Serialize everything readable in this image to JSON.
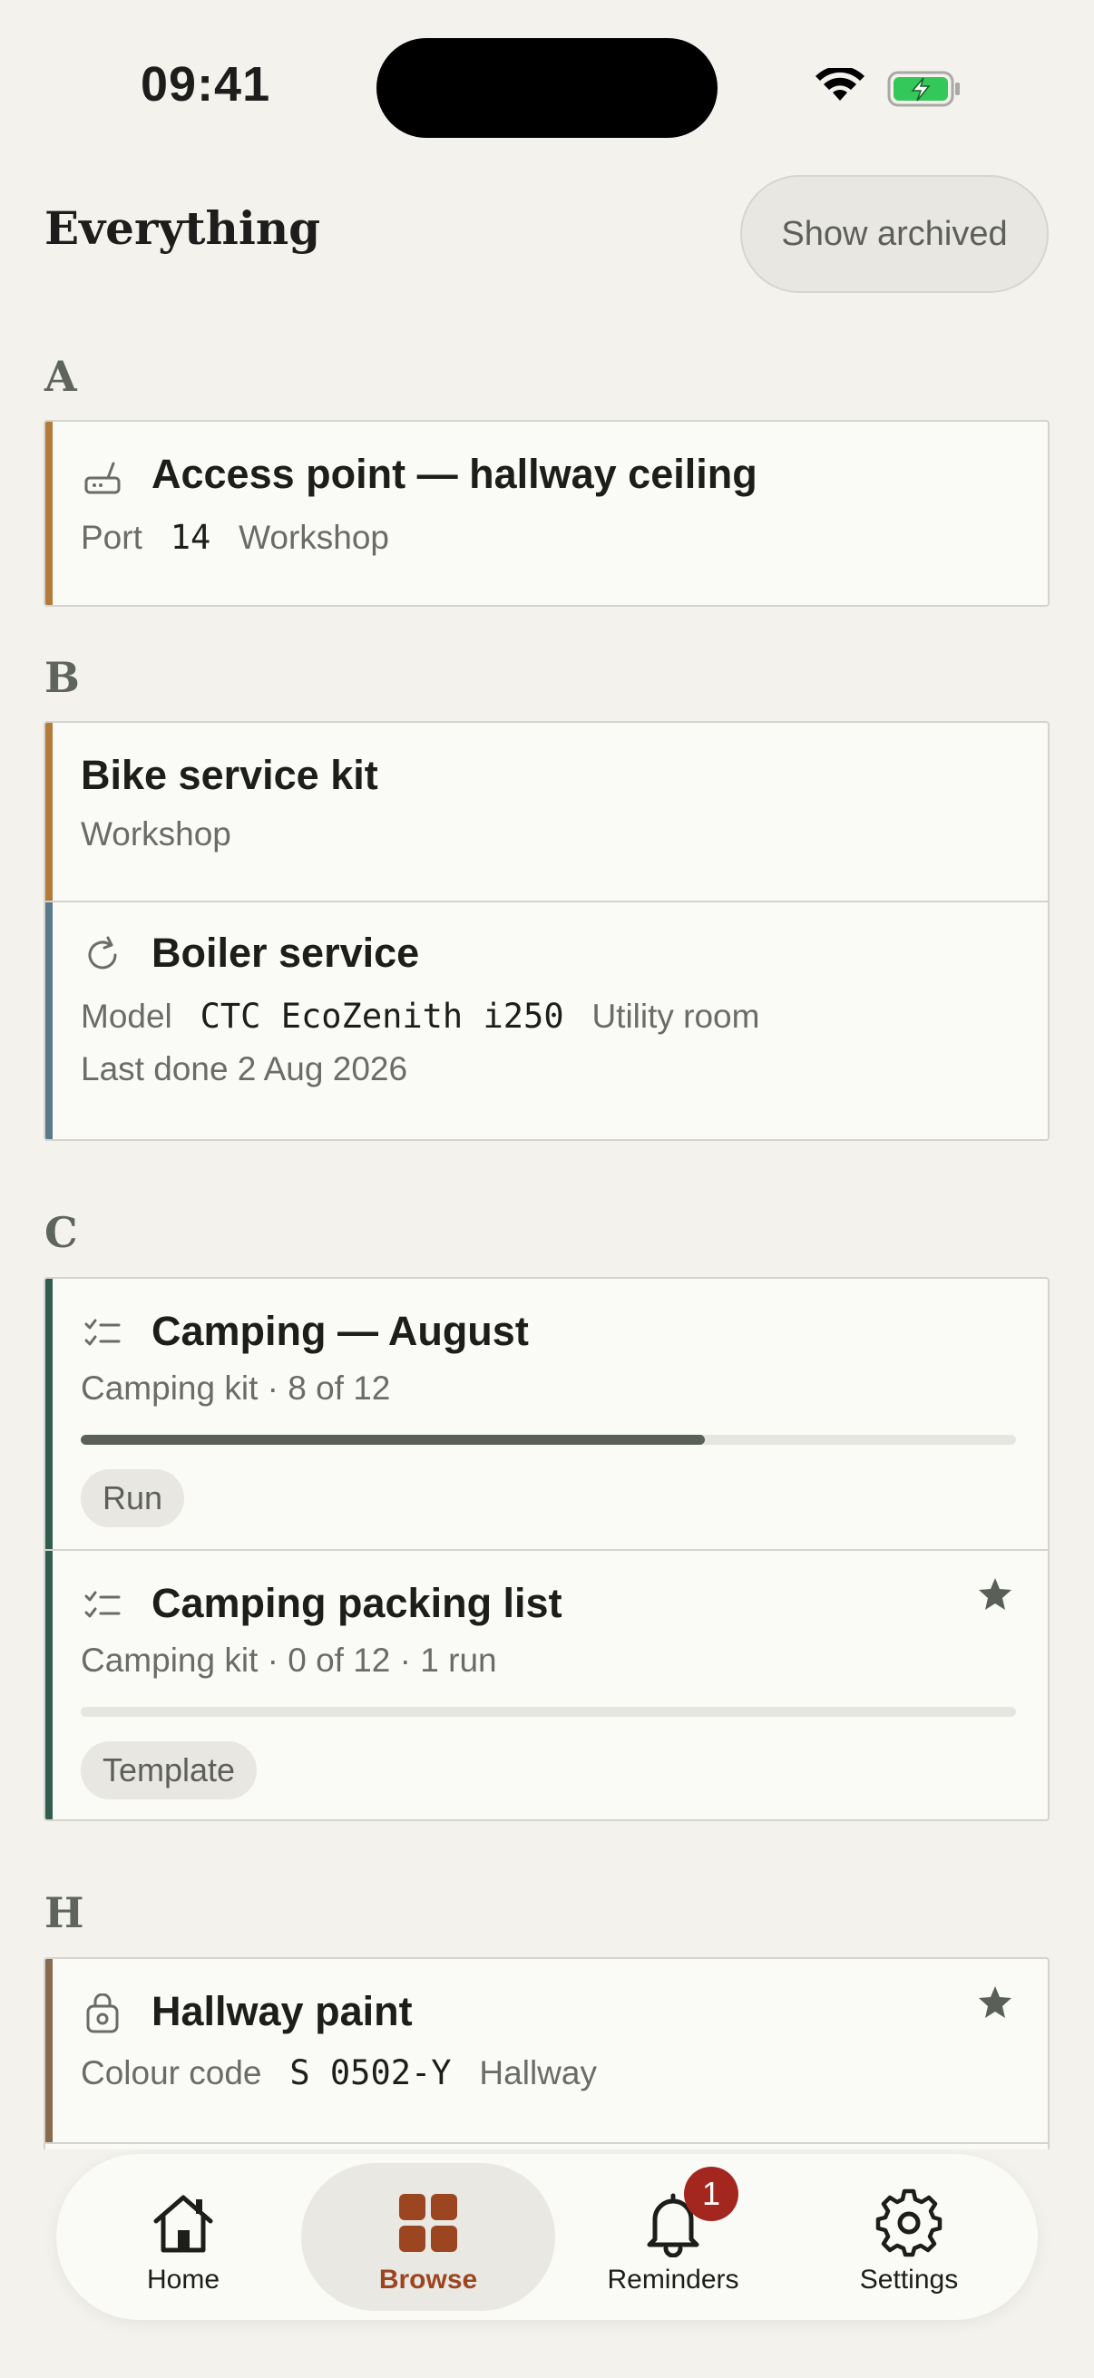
{
  "status_bar": {
    "time": "09:41"
  },
  "header": {
    "title": "Everything",
    "show_archived_label": "Show archived"
  },
  "sections": {
    "a": {
      "letter": "A",
      "items": [
        {
          "title": "Access point — hallway ceiling",
          "sub_label": "Port",
          "sub_code": "14",
          "location": "Workshop",
          "icon": "router-icon",
          "accent": "#b47a3a"
        }
      ]
    },
    "b": {
      "letter": "B",
      "items": [
        {
          "title": "Bike service kit",
          "location": "Workshop",
          "accent": "#b47a3a"
        },
        {
          "title": "Boiler service",
          "sub_label": "Model",
          "sub_code": "CTC EcoZenith i250",
          "location": "Utility room",
          "last_done": "Last done 2 Aug 2026",
          "icon": "refresh-icon",
          "accent": "#5a7a8c"
        }
      ]
    },
    "c": {
      "letter": "C",
      "items": [
        {
          "title": "Camping — August",
          "subtitle": "Camping kit · 8 of 12",
          "progress": 0.667,
          "tag": "Run",
          "icon": "checklist-icon",
          "accent": "#2f5e4e"
        },
        {
          "title": "Camping packing list",
          "subtitle": "Camping kit · 0 of 12 · 1 run",
          "progress": 0,
          "tag": "Template",
          "icon": "checklist-icon",
          "starred": true,
          "accent": "#2f5e4e"
        }
      ]
    },
    "h": {
      "letter": "H",
      "items": [
        {
          "title": "Hallway paint",
          "sub_label": "Colour code",
          "sub_code": "S 0502-Y",
          "location": "Hallway",
          "icon": "paint-can-icon",
          "starred": true,
          "accent": "#8a6a4c"
        }
      ]
    }
  },
  "tabbar": {
    "tabs": [
      {
        "label": "Home",
        "icon": "home-icon"
      },
      {
        "label": "Browse",
        "icon": "grid-icon",
        "active": true
      },
      {
        "label": "Reminders",
        "icon": "bell-icon",
        "badge": "1"
      },
      {
        "label": "Settings",
        "icon": "gear-icon"
      }
    ]
  },
  "colors": {
    "accent_brand": "#9c4621",
    "badge": "#a4271f"
  }
}
